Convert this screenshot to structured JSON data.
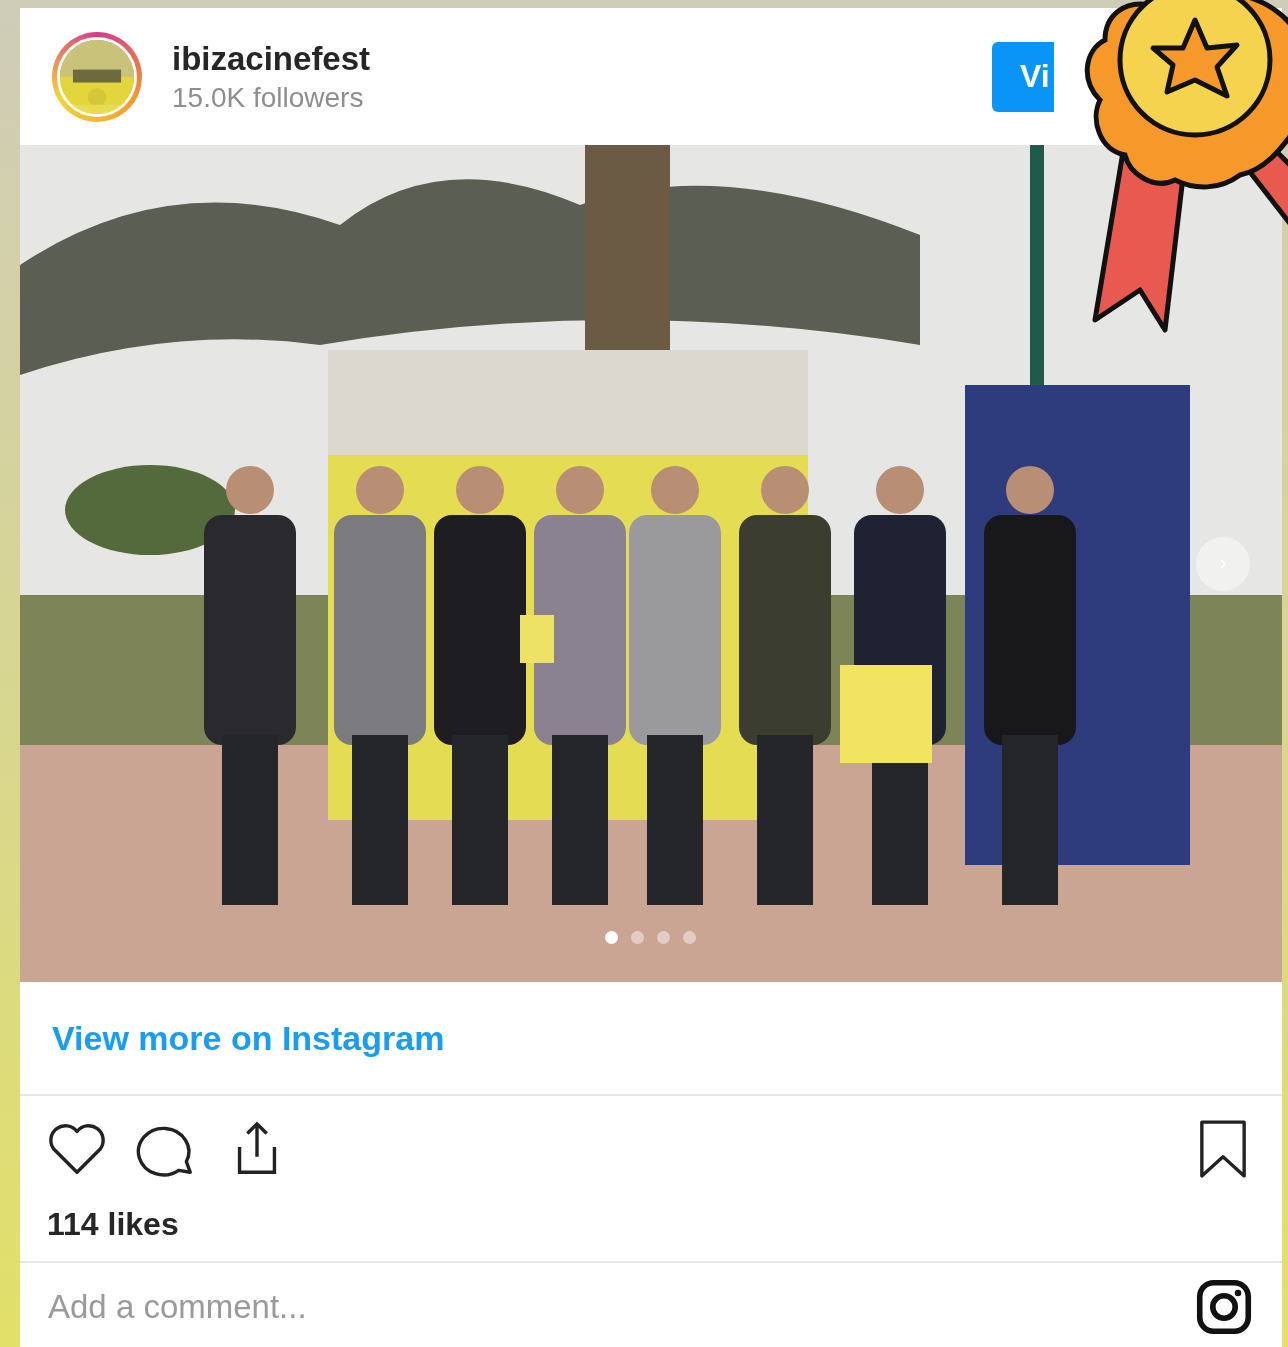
{
  "post": {
    "username": "ibizacinefest",
    "followers": "15.0K followers",
    "view_button": "Vi",
    "carousel_dots": [
      {
        "selected": true
      },
      {
        "selected": false
      },
      {
        "selected": false
      },
      {
        "selected": false
      }
    ],
    "view_more_link": "View more on Instagram",
    "likes": "114 likes",
    "comment_placeholder": "Add a comment..."
  }
}
